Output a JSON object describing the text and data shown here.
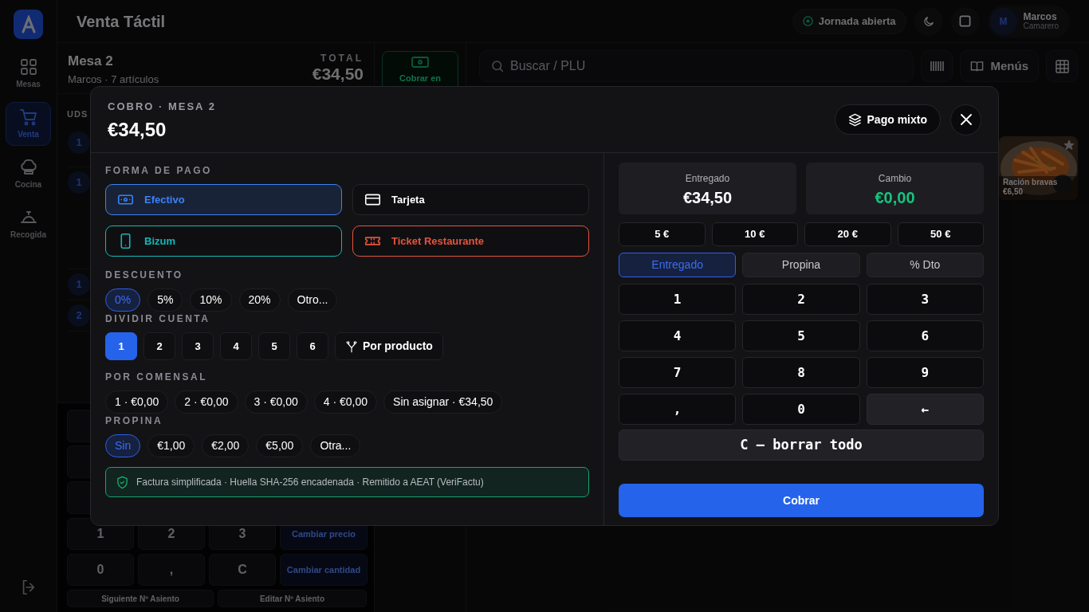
{
  "sidebar": {
    "items": [
      {
        "label": "Mesas",
        "selected": false
      },
      {
        "label": "Venta",
        "selected": true
      },
      {
        "label": "Cocina",
        "selected": false
      },
      {
        "label": "Recogida",
        "selected": false
      }
    ]
  },
  "header": {
    "title": "Venta Táctil",
    "status": "Jornada abierta",
    "user": {
      "initial": "M",
      "name": "Marcos",
      "role": "Camarero"
    }
  },
  "order": {
    "title": "Mesa 2",
    "subtitle": "Marcos · 7 artículos",
    "total_label": "TOTAL",
    "total": "€34,50",
    "column_1": "UDS",
    "quantities": [
      "1",
      "1",
      "1",
      "2"
    ],
    "keypad": [
      [
        {
          "label": "1",
          "kind": "key"
        },
        {
          "label": "2",
          "kind": "key"
        },
        {
          "label": "3",
          "kind": "key"
        },
        {
          "label": "Cambiar precio",
          "kind": "action"
        }
      ],
      [
        {
          "label": "0",
          "kind": "key"
        },
        {
          "label": ",",
          "kind": "key"
        },
        {
          "label": "C",
          "kind": "key"
        },
        {
          "label": "Cambiar cantidad",
          "kind": "action"
        }
      ]
    ],
    "seat_buttons": [
      "Siguiente Nº Asiento",
      "Editar Nº Asiento"
    ]
  },
  "pay_button": "Cobrar en",
  "search": {
    "placeholder": "Buscar / PLU"
  },
  "menus_button": "Menús",
  "products": [
    {
      "name": "Ración bravas",
      "price": "€6,50"
    }
  ],
  "payment": {
    "title": "COBRO · MESA 2",
    "amount": "€34,50",
    "mixed_button": "Pago mixto",
    "method_label": "FORMA DE PAGO",
    "methods": [
      {
        "label": "Efectivo",
        "color": "#3b82f6",
        "selected": true
      },
      {
        "label": "Tarjeta",
        "selected": false
      },
      {
        "label": "Bizum",
        "color": "#14b8b8",
        "selected": false
      },
      {
        "label": "Ticket Restaurante",
        "color": "#e5533d",
        "selected": false
      }
    ],
    "discount": {
      "label": "DESCUENTO",
      "options": [
        {
          "label": "0%",
          "selected": true
        },
        {
          "label": "5%",
          "selected": false
        },
        {
          "label": "10%",
          "selected": false
        },
        {
          "label": "20%",
          "selected": false
        },
        {
          "label": "Otro...",
          "selected": false
        }
      ]
    },
    "split": {
      "label": "DIVIDIR CUENTA",
      "options": [
        {
          "label": "1",
          "selected": true
        },
        {
          "label": "2",
          "selected": false
        },
        {
          "label": "3",
          "selected": false
        },
        {
          "label": "4",
          "selected": false
        },
        {
          "label": "5",
          "selected": false
        },
        {
          "label": "6",
          "selected": false
        }
      ],
      "by_product": "Por producto"
    },
    "diners": {
      "label": "POR COMENSAL",
      "items": [
        "1 · €0,00",
        "2 · €0,00",
        "3 · €0,00",
        "4 · €0,00",
        "Sin asignar · €34,50"
      ]
    },
    "tip": {
      "label": "PROPINA",
      "options": [
        {
          "label": "Sin",
          "selected": true
        },
        {
          "label": "€1,00",
          "selected": false
        },
        {
          "label": "€2,00",
          "selected": false
        },
        {
          "label": "€5,00",
          "selected": false
        },
        {
          "label": "Otra...",
          "selected": false
        }
      ]
    },
    "notice": "Factura simplificada · Huella SHA-256 encadenada · Remitido a AEAT (VeriFactu)",
    "tendered": {
      "label": "Entregado",
      "value": "€34,50"
    },
    "change": {
      "label": "Cambio",
      "value": "€0,00"
    },
    "quick_amounts": [
      "5 €",
      "10 €",
      "20 €",
      "50 €"
    ],
    "modes": [
      {
        "label": "Entregado",
        "selected": true
      },
      {
        "label": "Propina",
        "selected": false
      },
      {
        "label": "% Dto",
        "selected": false
      }
    ],
    "keys": [
      {
        "label": "1",
        "kind": "digit"
      },
      {
        "label": "2",
        "kind": "digit"
      },
      {
        "label": "3",
        "kind": "digit"
      },
      {
        "label": "4",
        "kind": "digit"
      },
      {
        "label": "5",
        "kind": "digit"
      },
      {
        "label": "6",
        "kind": "digit"
      },
      {
        "label": "7",
        "kind": "digit"
      },
      {
        "label": "8",
        "kind": "digit"
      },
      {
        "label": "9",
        "kind": "digit"
      },
      {
        "label": ",",
        "kind": "digit"
      },
      {
        "label": "0",
        "kind": "digit"
      },
      {
        "label": "←",
        "kind": "backspace"
      }
    ],
    "clear_key": "C — borrar todo",
    "charge_button": "Cobrar"
  }
}
